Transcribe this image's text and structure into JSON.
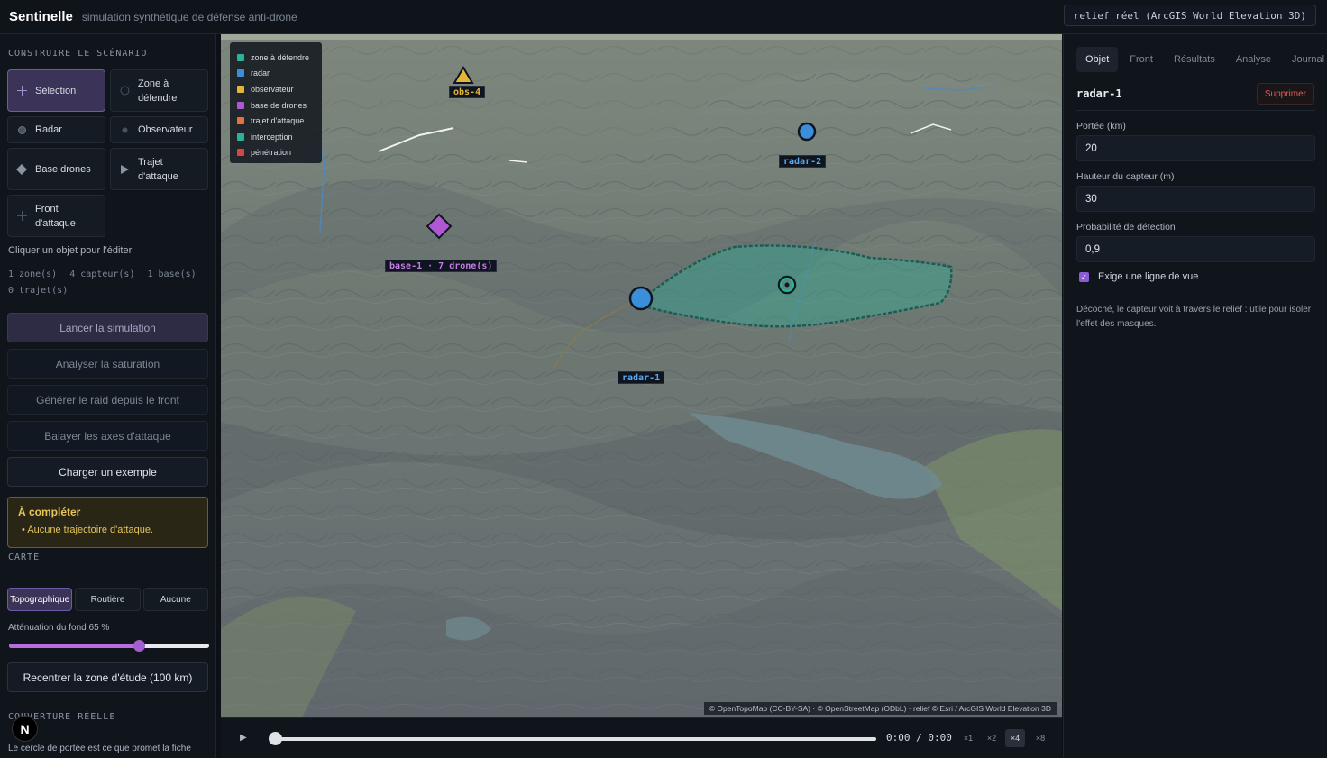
{
  "header": {
    "title": "Sentinelle",
    "subtitle": "simulation synthétique de défense anti-drone",
    "terrain_badge": "relief réel (ArcGIS World Elevation 3D)"
  },
  "sidebar": {
    "scenario_title": "CONSTRUIRE LE SCÉNARIO",
    "tools": [
      {
        "label": "Sélection",
        "icon": "crosshair-icon",
        "active": true
      },
      {
        "label": "Zone à défendre",
        "icon": "circle-outline-icon"
      },
      {
        "label": "Radar",
        "icon": "radar-dot-icon"
      },
      {
        "label": "Observateur",
        "icon": "observer-dot-icon"
      },
      {
        "label": "Base drones",
        "icon": "diamond-icon"
      },
      {
        "label": "Trajet d'attaque",
        "icon": "play-triangle-icon"
      },
      {
        "label": "Front d'attaque",
        "icon": "plus-icon"
      }
    ],
    "hint": "Cliquer un objet pour l'éditer",
    "counts": [
      "1 zone(s)",
      "4 capteur(s)",
      "1 base(s)",
      "0 trajet(s)"
    ],
    "actions": {
      "run": "Lancer la simulation",
      "saturation": "Analyser la saturation",
      "generate_raid": "Générer le raid depuis le front",
      "sweep": "Balayer les axes d'attaque",
      "load_example": "Charger un exemple"
    },
    "todo": {
      "title": "À compléter",
      "items": [
        "Aucune trajectoire d'attaque."
      ]
    },
    "map_title": "CARTE",
    "map_styles": [
      "Topographique",
      "Routière",
      "Aucune"
    ],
    "map_style_active": "Topographique",
    "attenuation_label": "Atténuation du fond 65  %",
    "attenuation_value": 65,
    "recenter": "Recentrer la zone d'étude (100 km)",
    "coverage_title": "COUVERTURE RÉELLE",
    "coverage_text": "Le cercle de portée est ce que promet la fiche",
    "n_badge": "N"
  },
  "map": {
    "legend": [
      {
        "label": "zone à défendre",
        "color": "#2bb39a"
      },
      {
        "label": "radar",
        "color": "#3b8fd8"
      },
      {
        "label": "observateur",
        "color": "#e3b53a"
      },
      {
        "label": "base de drones",
        "color": "#b057d6"
      },
      {
        "label": "trajet d'attaque",
        "color": "#e8703d"
      },
      {
        "label": "interception",
        "color": "#2bb39a"
      },
      {
        "label": "pénétration",
        "color": "#d9463f"
      }
    ],
    "labels": {
      "obs4": "obs-4",
      "radar2": "radar-2",
      "base1": "base-1 · 7 drone(s)",
      "radar1": "radar-1"
    },
    "attribution": "© OpenTopoMap (CC-BY-SA) · © OpenStreetMap (ODbL) · relief © Esri / ArcGIS World Elevation 3D",
    "colors": {
      "radar": "#3b8fd8",
      "observer": "#e3b53a",
      "base": "#b057d6",
      "zone": "#2bb39a"
    }
  },
  "timeline": {
    "play_icon": "play-icon",
    "time": "0:00 / 0:00",
    "speeds": [
      "×1",
      "×2",
      "×4",
      "×8"
    ],
    "active_speed": "×4",
    "progress": 0
  },
  "panel": {
    "tabs": [
      "Objet",
      "Front",
      "Résultats",
      "Analyse",
      "Journal"
    ],
    "active_tab": "Objet",
    "object_name": "radar-1",
    "delete": "Supprimer",
    "fields": [
      {
        "label": "Portée (km)",
        "value": "20"
      },
      {
        "label": "Hauteur du capteur (m)",
        "value": "30"
      },
      {
        "label": "Probabilité de détection",
        "value": "0,9"
      }
    ],
    "los_label": "Exige une ligne de vue",
    "los_checked": true,
    "note": "Décoché, le capteur voit à travers le relief : utile pour isoler l'effet des masques."
  }
}
